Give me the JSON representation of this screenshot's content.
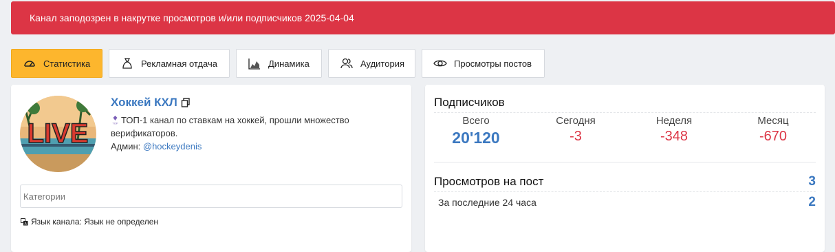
{
  "alert": {
    "text": "Канал заподозрен в накрутке просмотров и/или подписчиков 2025-04-04",
    "color": "#dc3545"
  },
  "tabs": [
    {
      "label": "Статистика",
      "icon": "speedometer-icon",
      "active": true
    },
    {
      "label": "Рекламная отдача",
      "icon": "money-bag-icon",
      "active": false
    },
    {
      "label": "Динамика",
      "icon": "area-chart-icon",
      "active": false
    },
    {
      "label": "Аудитория",
      "icon": "users-icon",
      "active": false
    },
    {
      "label": "Просмотры постов",
      "icon": "eye-icon",
      "active": false
    }
  ],
  "channel": {
    "title": "Хоккей КХЛ",
    "avatar_text": "LIVE",
    "description": "ТОП-1 канал по ставкам на хоккей, прошли множество верификаторов.",
    "admin_label": "Админ:",
    "admin_handle": "@hockeydenis",
    "categories_placeholder": "Категории",
    "language": "Язык канала: Язык не определен"
  },
  "subscribers": {
    "title": "Подписчиков",
    "columns": [
      {
        "label": "Всего",
        "value": "20'120"
      },
      {
        "label": "Сегодня",
        "value": "-3"
      },
      {
        "label": "Неделя",
        "value": "-348"
      },
      {
        "label": "Месяц",
        "value": "-670"
      }
    ]
  },
  "views": {
    "title": "Просмотров на пост",
    "value": "3",
    "sub_label": "За последние 24 часа",
    "sub_value": "2"
  },
  "colors": {
    "accent": "#fdb62d",
    "link": "#3b78c0",
    "negative": "#dc3545"
  }
}
